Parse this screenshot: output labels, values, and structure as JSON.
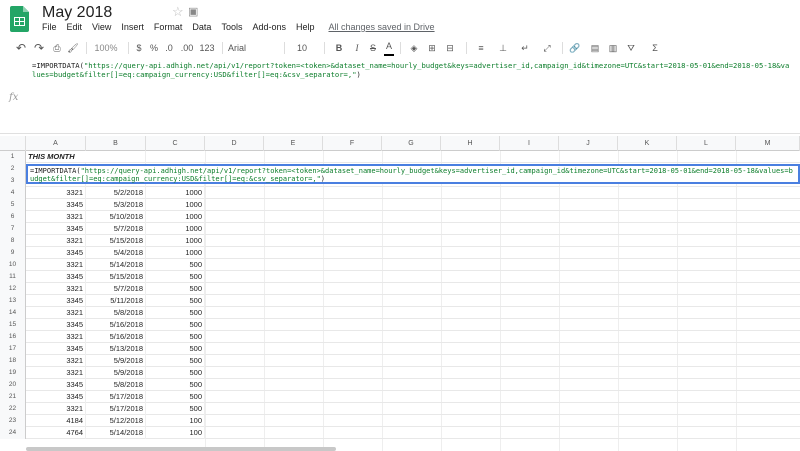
{
  "doc": {
    "title": "May 2018",
    "saved_status": "All changes saved in Drive"
  },
  "menu": [
    "File",
    "Edit",
    "View",
    "Insert",
    "Format",
    "Data",
    "Tools",
    "Add-ons",
    "Help"
  ],
  "toolbar": {
    "zoom": "100%",
    "currency": "$",
    "percent": "%",
    "dec_less": ".0",
    "dec_more": ".00",
    "number_format": "123",
    "font": "Arial",
    "font_size": "10",
    "bold": "B",
    "italic": "I",
    "strike": "S",
    "text_color": "A"
  },
  "formula": {
    "prefix": "=IMPORTDATA(",
    "string": "\"https://query-api.adhigh.net/api/v1/report?token=<token>&dataset_name=hourly_budget&keys=advertiser_id,campaign_id&timezone=UTC&start=2018-05-01&end=2018-05-18&values=budget&filter[]=eq:campaign_currency:USD&filter[]=eq:&csv_separator=,\"",
    "suffix": ")"
  },
  "fx_label": "fx",
  "columns": [
    "A",
    "B",
    "C",
    "D",
    "E",
    "F",
    "G",
    "H",
    "I",
    "J",
    "K",
    "L",
    "M"
  ],
  "row1_label": "THIS MONTH",
  "rows": [
    {
      "n": "1",
      "a": "",
      "b": "",
      "c": ""
    },
    {
      "n": "2",
      "a": "",
      "b": "",
      "c": ""
    },
    {
      "n": "3",
      "a": "",
      "b": "",
      "c": ""
    },
    {
      "n": "4",
      "a": "3321",
      "b": "5/2/2018",
      "c": "1000"
    },
    {
      "n": "5",
      "a": "3345",
      "b": "5/3/2018",
      "c": "1000"
    },
    {
      "n": "6",
      "a": "3321",
      "b": "5/10/2018",
      "c": "1000"
    },
    {
      "n": "7",
      "a": "3345",
      "b": "5/7/2018",
      "c": "1000"
    },
    {
      "n": "8",
      "a": "3321",
      "b": "5/15/2018",
      "c": "1000"
    },
    {
      "n": "9",
      "a": "3345",
      "b": "5/4/2018",
      "c": "1000"
    },
    {
      "n": "10",
      "a": "3321",
      "b": "5/14/2018",
      "c": "500"
    },
    {
      "n": "11",
      "a": "3345",
      "b": "5/15/2018",
      "c": "500"
    },
    {
      "n": "12",
      "a": "3321",
      "b": "5/7/2018",
      "c": "500"
    },
    {
      "n": "13",
      "a": "3345",
      "b": "5/11/2018",
      "c": "500"
    },
    {
      "n": "14",
      "a": "3321",
      "b": "5/8/2018",
      "c": "500"
    },
    {
      "n": "15",
      "a": "3345",
      "b": "5/16/2018",
      "c": "500"
    },
    {
      "n": "16",
      "a": "3321",
      "b": "5/16/2018",
      "c": "500"
    },
    {
      "n": "17",
      "a": "3345",
      "b": "5/13/2018",
      "c": "500"
    },
    {
      "n": "18",
      "a": "3321",
      "b": "5/9/2018",
      "c": "500"
    },
    {
      "n": "19",
      "a": "3321",
      "b": "5/9/2018",
      "c": "500"
    },
    {
      "n": "20",
      "a": "3345",
      "b": "5/8/2018",
      "c": "500"
    },
    {
      "n": "21",
      "a": "3345",
      "b": "5/17/2018",
      "c": "500"
    },
    {
      "n": "22",
      "a": "3321",
      "b": "5/17/2018",
      "c": "500"
    },
    {
      "n": "23",
      "a": "4184",
      "b": "5/12/2018",
      "c": "100"
    },
    {
      "n": "24",
      "a": "4764",
      "b": "5/14/2018",
      "c": "100"
    }
  ],
  "colors": {
    "accent": "#4a7fe0",
    "string": "#0b7d2a",
    "logo": "#23a566"
  }
}
